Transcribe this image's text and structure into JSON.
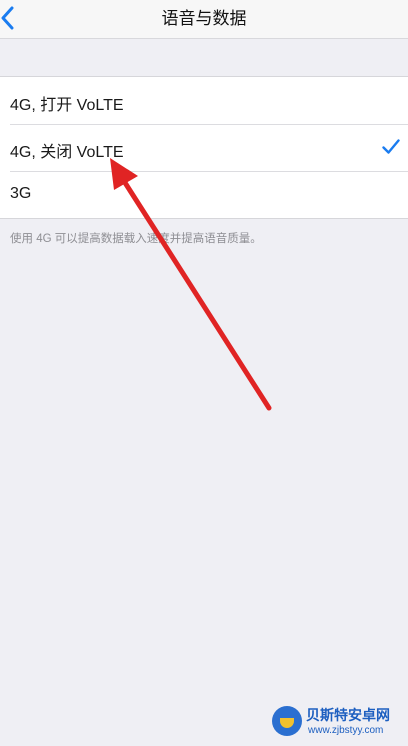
{
  "nav": {
    "back_icon": "chevron-left-icon",
    "title": "语音与数据"
  },
  "options": [
    {
      "label": "4G, 打开 VoLTE",
      "selected": false
    },
    {
      "label": "4G, 关闭 VoLTE",
      "selected": true
    },
    {
      "label": "3G",
      "selected": false
    }
  ],
  "footnote": "使用 4G 可以提高数据载入速度并提高语音质量。",
  "colors": {
    "accent": "#1a7cf0",
    "background": "#efeff4",
    "annotation_arrow": "#e02424"
  },
  "watermark": {
    "title": "贝斯特安卓网",
    "url": "www.zjbstyy.com"
  }
}
